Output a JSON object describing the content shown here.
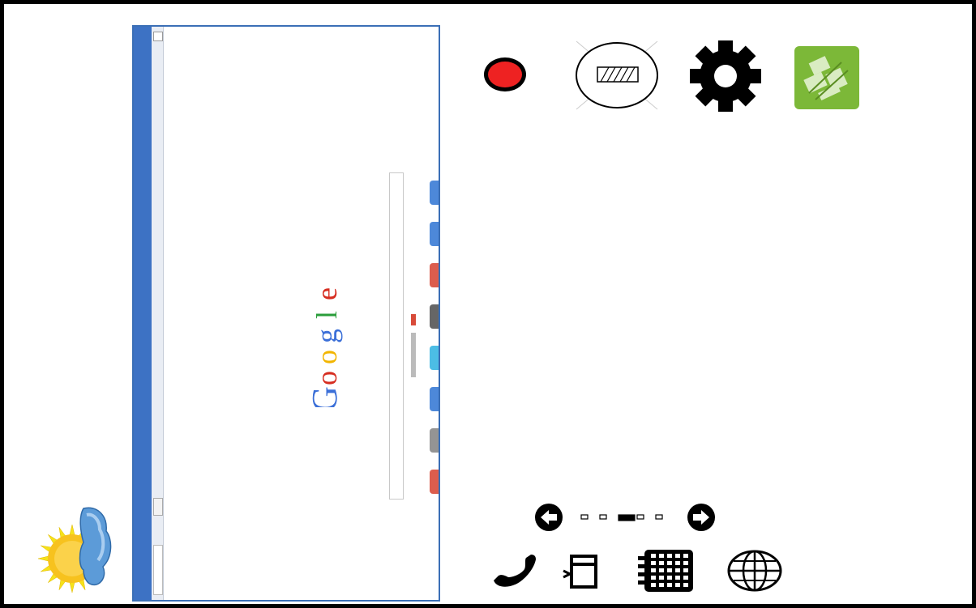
{
  "screenshot": {
    "logo_text": [
      "G",
      "o",
      "o",
      "g",
      "l",
      "e"
    ],
    "logo_colors": [
      "#3b6fd8",
      "#d62d20",
      "#f2b500",
      "#3b6fd8",
      "#2a9d3a",
      "#d62d20"
    ]
  },
  "toolbar": {
    "record_icon": "record-icon",
    "clear_icon": "clear-icon",
    "settings_icon": "gear-icon",
    "app_icon": "green-app-icon"
  },
  "pager": {
    "pages": 5,
    "current": 3
  },
  "dock": {
    "icons": [
      "phone-icon",
      "window-icon",
      "calendar-grid-icon",
      "globe-icon"
    ]
  },
  "colors": {
    "record": "#ee2222",
    "app_green": "#7cb838",
    "frame_blue": "#3b6fb6"
  }
}
